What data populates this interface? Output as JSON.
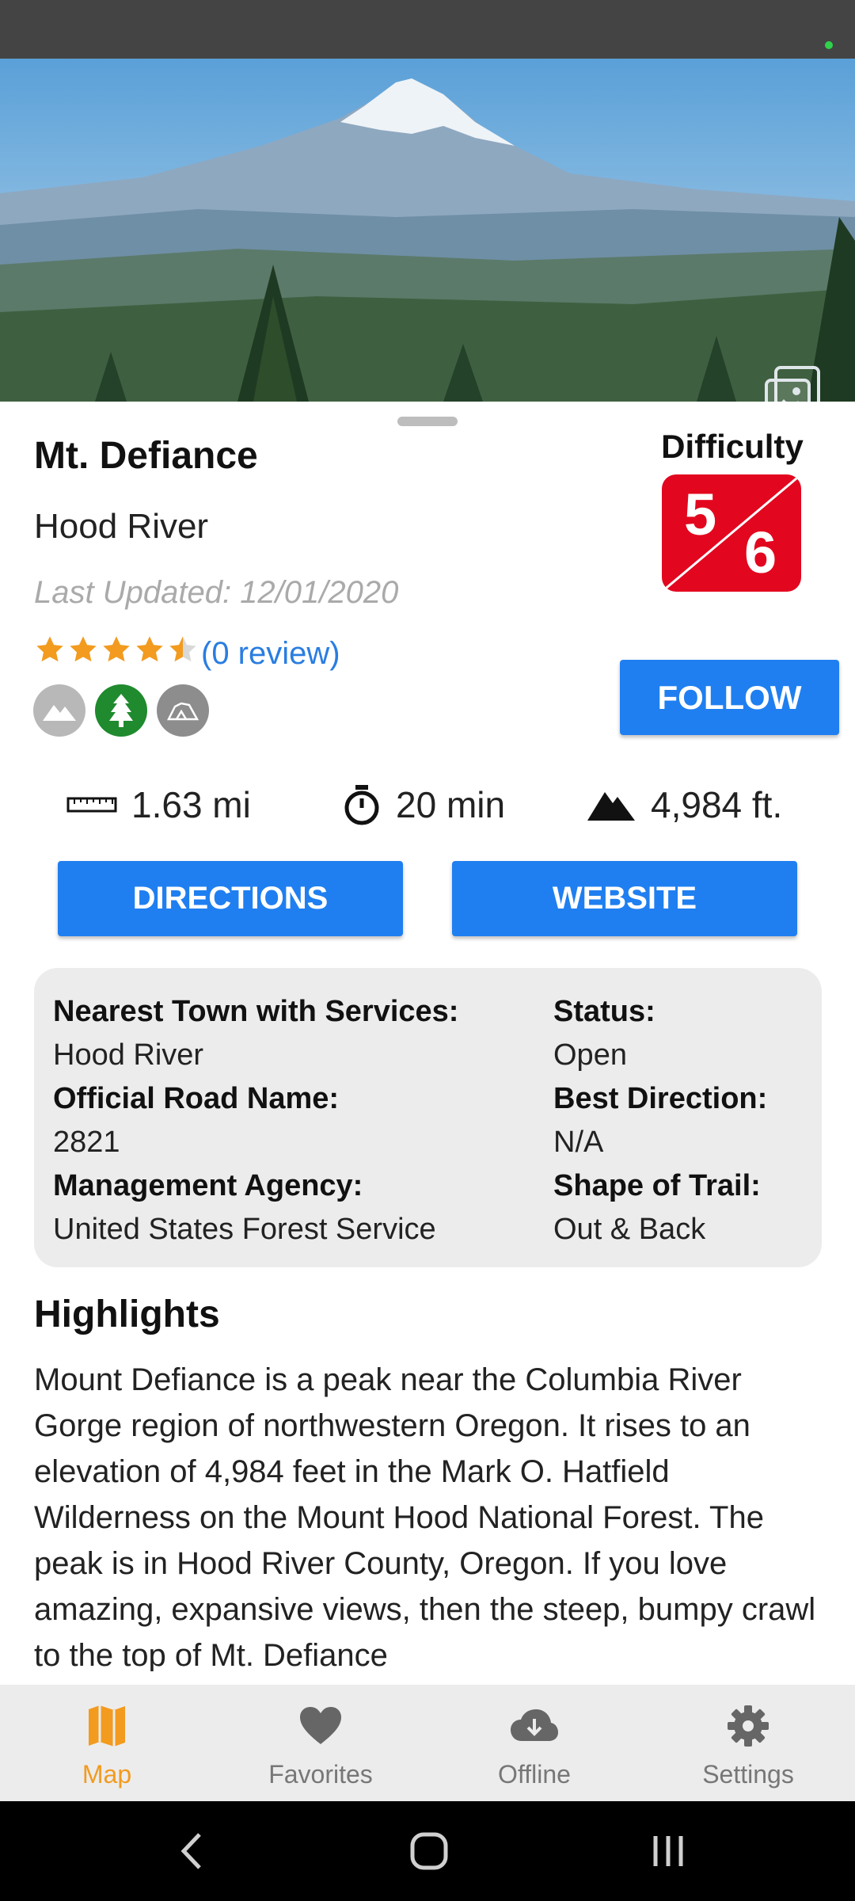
{
  "trail": {
    "name": "Mt. Defiance",
    "region": "Hood River",
    "last_updated": "Last Updated: 12/01/2020",
    "rating": 4.5,
    "reviews": "(0 review)",
    "follow_label": "FOLLOW",
    "type_icons": [
      "mountain-icon",
      "forest-icon",
      "rock-icon"
    ]
  },
  "difficulty": {
    "label": "Difficulty",
    "value": "5",
    "max": "6",
    "color": "#e2071f"
  },
  "stats": {
    "distance": "1.63 mi",
    "time": "20 min",
    "elevation": "4,984 ft."
  },
  "actions": {
    "directions": "DIRECTIONS",
    "website": "WEBSITE",
    "accent": "#1f7ff0"
  },
  "details": {
    "nearest_town_label": "Nearest Town with Services:",
    "nearest_town": "Hood River",
    "road_label": "Official Road Name:",
    "road": "2821",
    "agency_label": "Management Agency:",
    "agency": "United States Forest Service",
    "status_label": "Status:",
    "status": "Open",
    "direction_label": "Best Direction:",
    "direction": "N/A",
    "shape_label": "Shape of Trail:",
    "shape": "Out & Back"
  },
  "highlights": {
    "title": "Highlights",
    "body": "Mount Defiance is a peak near the Columbia River Gorge region of northwestern Oregon. It rises to an elevation of 4,984 feet in the Mark O. Hatfield Wilderness on the Mount Hood National Forest. The peak is in Hood River County, Oregon. If you love amazing, expansive views, then the steep, bumpy crawl to the top of Mt. Defiance"
  },
  "tabs": [
    {
      "label": "Map",
      "icon": "map-icon",
      "active": true
    },
    {
      "label": "Favorites",
      "icon": "heart-icon",
      "active": false
    },
    {
      "label": "Offline",
      "icon": "cloud-download-icon",
      "active": false
    },
    {
      "label": "Settings",
      "icon": "gear-icon",
      "active": false
    }
  ],
  "colors": {
    "tab_active": "#f29b1f",
    "tab_inactive": "#777777"
  }
}
